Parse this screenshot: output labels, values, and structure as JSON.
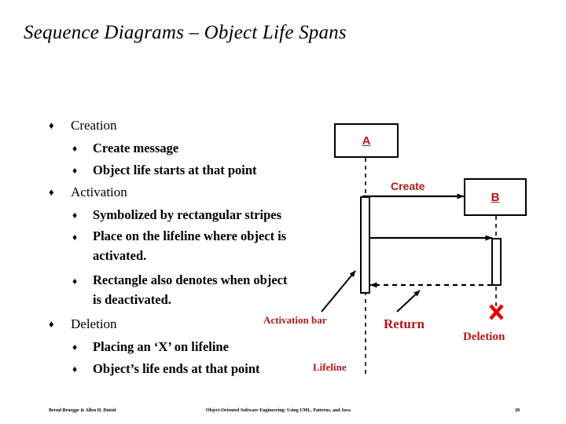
{
  "slide": {
    "title": "Sequence Diagrams – Object Life Spans"
  },
  "outline": [
    {
      "level": 1,
      "bullet": "♦",
      "text": "Creation"
    },
    {
      "level": 2,
      "bullet": "♦",
      "text": "Create message"
    },
    {
      "level": 2,
      "bullet": "♦",
      "text": "Object life starts at that point"
    },
    {
      "level": 1,
      "bullet": "♦",
      "text": "Activation"
    },
    {
      "level": 2,
      "bullet": "♦",
      "text": "Symbolized by rectangular stripes"
    },
    {
      "level": 2,
      "bullet": "♦",
      "text": "Place on the lifeline where object is",
      "text2": "activated."
    },
    {
      "level": 2,
      "bullet": "♦",
      "text": "Rectangle also denotes when object",
      "text2": "is deactivated."
    },
    {
      "level": 1,
      "bullet": "♦",
      "text": "Deletion"
    },
    {
      "level": 2,
      "bullet": "♦",
      "text": "Placing an ‘X’ on lifeline"
    },
    {
      "level": 2,
      "bullet": "♦",
      "text": "Object’s life ends at that point"
    }
  ],
  "diagram": {
    "objects": [
      {
        "id": "A",
        "label": "A"
      },
      {
        "id": "B",
        "label": "B"
      }
    ],
    "messages": [
      {
        "id": "create",
        "label": "Create",
        "kind": "solid-arrow",
        "from": "A",
        "to": "B"
      },
      {
        "id": "call",
        "label": "",
        "kind": "solid-arrow",
        "from": "A",
        "to": "B"
      },
      {
        "id": "return",
        "label": "Return",
        "kind": "dashed-arrow",
        "from": "B",
        "to": "A"
      }
    ],
    "annotations": {
      "activation_bar": "Activation bar",
      "return": "Return",
      "lifeline": "Lifeline",
      "deletion": "Deletion",
      "deletion_mark": "X"
    },
    "colors": {
      "label_red": "#b01818",
      "deletion_red": "#e00000",
      "line_black": "#000000"
    }
  },
  "footer": {
    "author": "Bernd Bruegge & Allen H. Dutoit",
    "book": "Object-Oriented Software Engineering: Using UML, Patterns, and Java",
    "page": "28"
  }
}
